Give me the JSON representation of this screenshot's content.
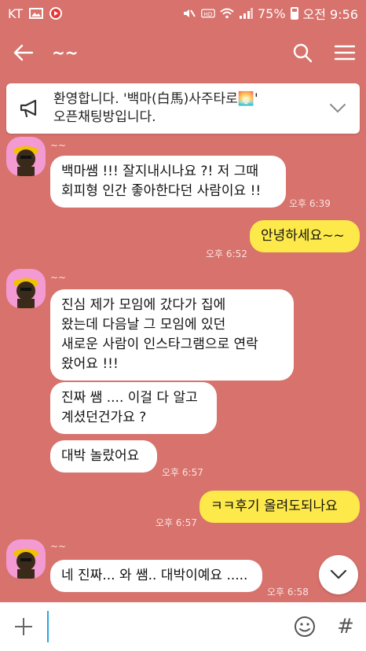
{
  "status_bar": {
    "carrier": "KT",
    "battery": "75%",
    "time": "오전 9:56"
  },
  "header": {
    "title": "~~"
  },
  "notice": {
    "line1": "환영합니다. '백마(白馬)사주타로🌅'",
    "line2": "오픈채팅방입니다."
  },
  "messages": [
    {
      "sender": "~~",
      "lines": [
        "백마쌤 !!! 잘지내시나요 ?! 저 그때",
        "회피형 인간 좋아한다던 사람이요 !!"
      ],
      "time": "오후 6:39"
    },
    {
      "mine": true,
      "text": "안녕하세요~~",
      "time": "오후 6:52"
    },
    {
      "sender": "~~",
      "lines": [
        "진심 제가 모임에 갔다가 집에",
        "왔는데 다음날 그 모임에 있던",
        "새로운 사람이 인스타그램으로 연락",
        "왔어요 !!!"
      ]
    },
    {
      "lines": [
        "진짜 쌤 .... 이걸 다 알고",
        "계셨던건가요 ?"
      ]
    },
    {
      "text": "대박 놀랐어요",
      "time": "오후 6:57"
    },
    {
      "mine": true,
      "text": "ㅋㅋ후기 올려도되나요",
      "time": "오후 6:57"
    },
    {
      "sender": "~~",
      "text": "네 진짜... 와 쌤.. 대박이예요 .....",
      "time": "오후 6:58"
    }
  ],
  "input": {
    "placeholder": ""
  }
}
